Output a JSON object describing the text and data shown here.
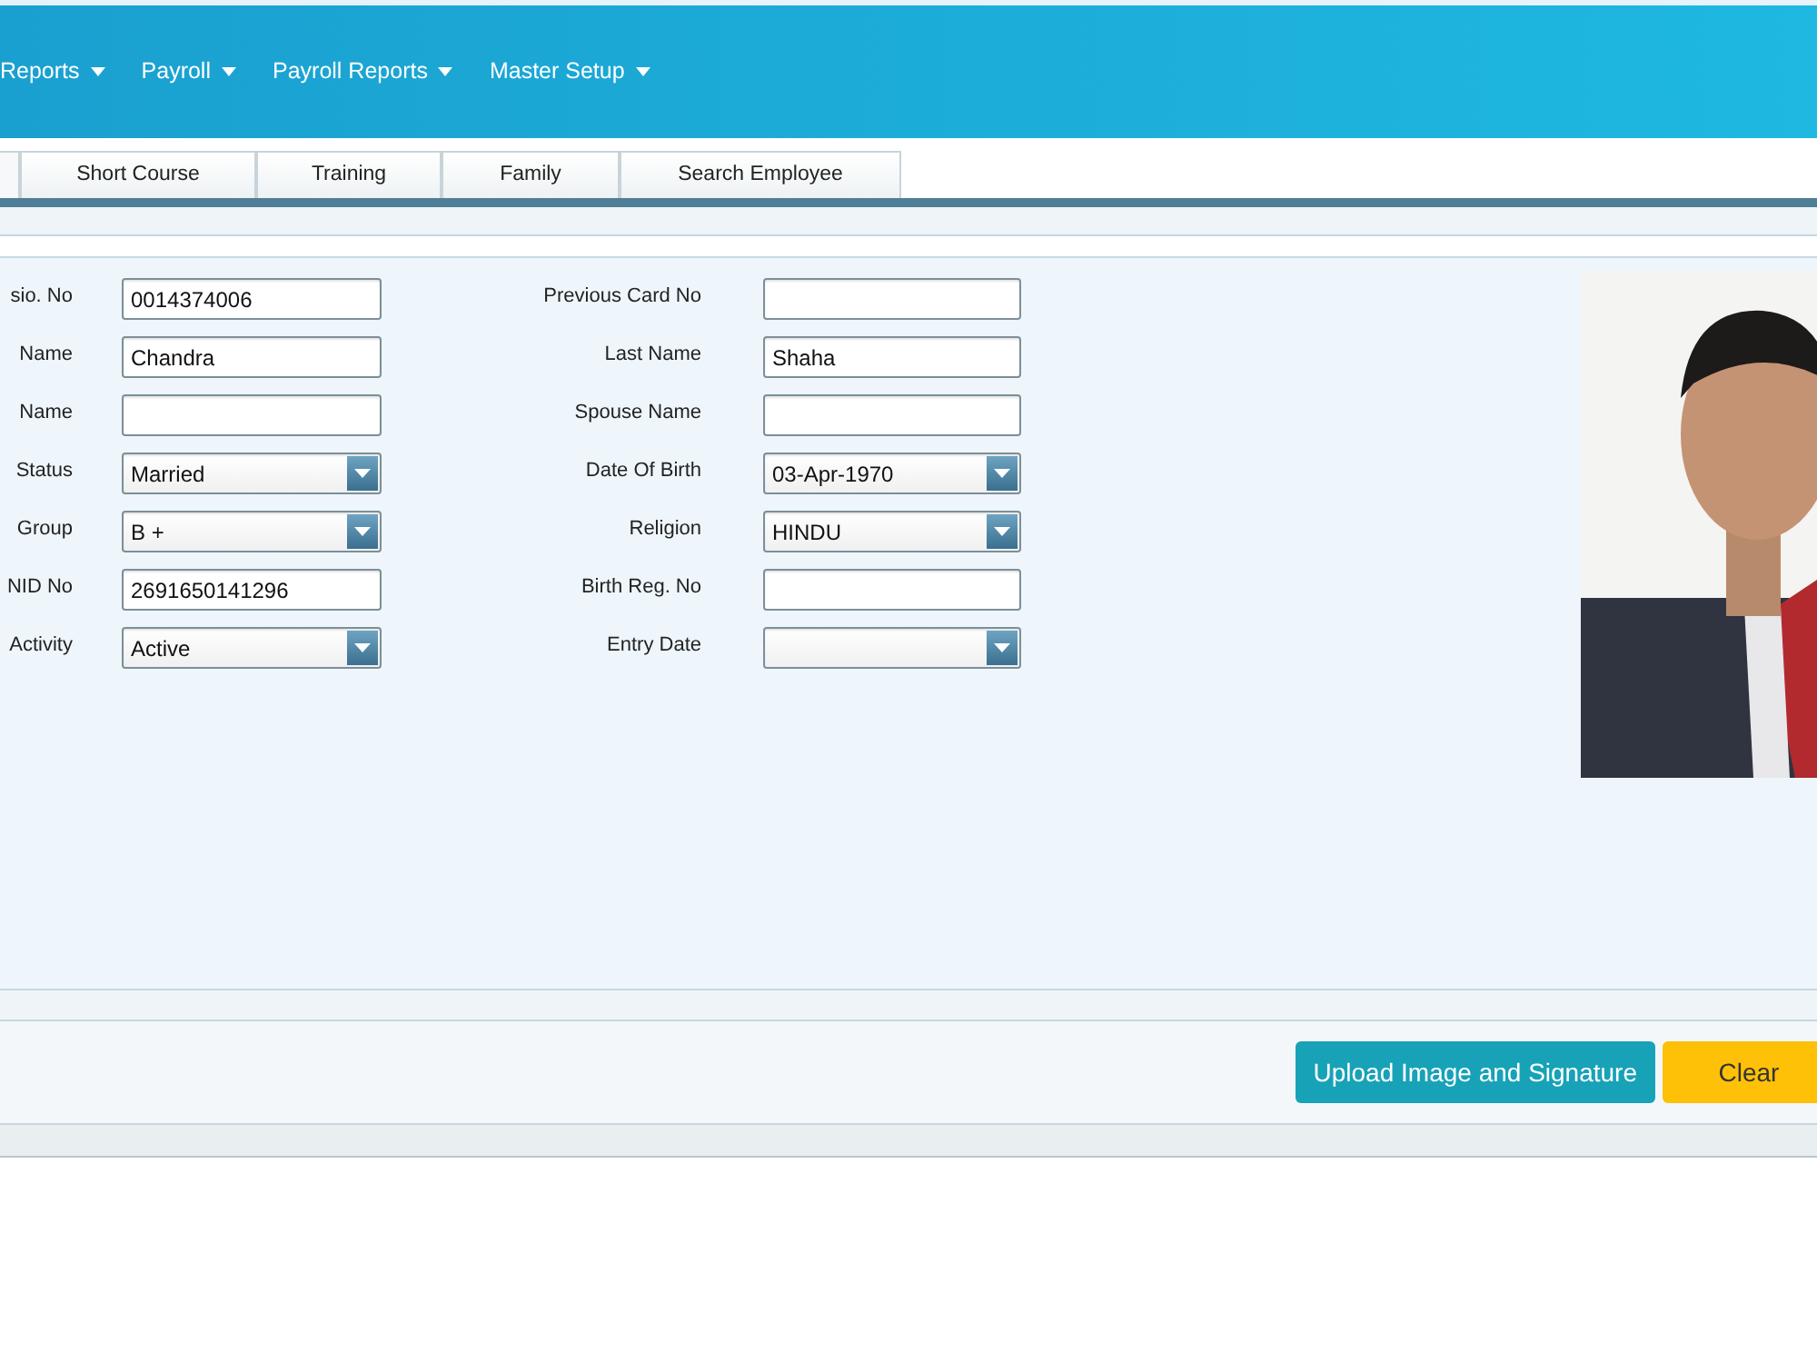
{
  "menu": [
    {
      "label": "Reports"
    },
    {
      "label": "Payroll"
    },
    {
      "label": "Payroll Reports"
    },
    {
      "label": "Master Setup"
    }
  ],
  "tabs": [
    {
      "label": "Short Course",
      "selected": false
    },
    {
      "label": "Training",
      "selected": false
    },
    {
      "label": "Family",
      "selected": false
    },
    {
      "label": "Search Employee",
      "selected": false
    }
  ],
  "left_fields": [
    {
      "label": "sio. No",
      "kind": "text",
      "value": "0014374006"
    },
    {
      "label": "Name",
      "kind": "text",
      "value": "Chandra"
    },
    {
      "label": "Name",
      "kind": "text"
    },
    {
      "label": "Status",
      "kind": "select",
      "value": "Married"
    },
    {
      "label": "Group",
      "kind": "select",
      "value": "B +"
    },
    {
      "label": "NID No",
      "kind": "text",
      "value": "2691650141296"
    },
    {
      "label": "Activity",
      "kind": "select",
      "value": "Active"
    }
  ],
  "right_fields": [
    {
      "label": "Previous Card No",
      "kind": "text"
    },
    {
      "label": "Last Name",
      "kind": "text",
      "value": "Shaha"
    },
    {
      "label": "Spouse Name",
      "kind": "text"
    },
    {
      "label": "Date Of Birth",
      "kind": "select",
      "value": "03-Apr-1970"
    },
    {
      "label": "Religion",
      "kind": "select",
      "value": "HINDU"
    },
    {
      "label": "Birth Reg. No",
      "kind": "text"
    },
    {
      "label": "Entry Date",
      "kind": "select"
    }
  ],
  "buttons": [
    {
      "label": "Upload Image and Signature",
      "kind": "info"
    },
    {
      "label": "Clear",
      "kind": "warning"
    }
  ]
}
